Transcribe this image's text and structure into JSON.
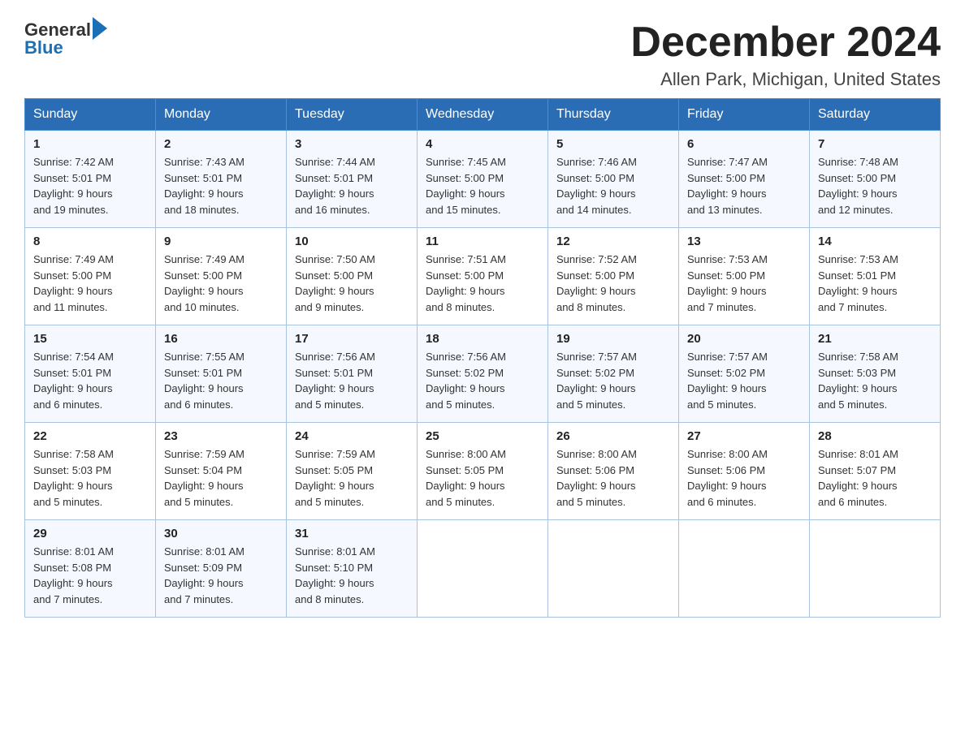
{
  "header": {
    "logo_general": "General",
    "logo_blue": "Blue",
    "month_title": "December 2024",
    "location": "Allen Park, Michigan, United States"
  },
  "days_of_week": [
    "Sunday",
    "Monday",
    "Tuesday",
    "Wednesday",
    "Thursday",
    "Friday",
    "Saturday"
  ],
  "weeks": [
    [
      {
        "day": "1",
        "sunrise": "7:42 AM",
        "sunset": "5:01 PM",
        "daylight": "9 hours and 19 minutes."
      },
      {
        "day": "2",
        "sunrise": "7:43 AM",
        "sunset": "5:01 PM",
        "daylight": "9 hours and 18 minutes."
      },
      {
        "day": "3",
        "sunrise": "7:44 AM",
        "sunset": "5:01 PM",
        "daylight": "9 hours and 16 minutes."
      },
      {
        "day": "4",
        "sunrise": "7:45 AM",
        "sunset": "5:00 PM",
        "daylight": "9 hours and 15 minutes."
      },
      {
        "day": "5",
        "sunrise": "7:46 AM",
        "sunset": "5:00 PM",
        "daylight": "9 hours and 14 minutes."
      },
      {
        "day": "6",
        "sunrise": "7:47 AM",
        "sunset": "5:00 PM",
        "daylight": "9 hours and 13 minutes."
      },
      {
        "day": "7",
        "sunrise": "7:48 AM",
        "sunset": "5:00 PM",
        "daylight": "9 hours and 12 minutes."
      }
    ],
    [
      {
        "day": "8",
        "sunrise": "7:49 AM",
        "sunset": "5:00 PM",
        "daylight": "9 hours and 11 minutes."
      },
      {
        "day": "9",
        "sunrise": "7:49 AM",
        "sunset": "5:00 PM",
        "daylight": "9 hours and 10 minutes."
      },
      {
        "day": "10",
        "sunrise": "7:50 AM",
        "sunset": "5:00 PM",
        "daylight": "9 hours and 9 minutes."
      },
      {
        "day": "11",
        "sunrise": "7:51 AM",
        "sunset": "5:00 PM",
        "daylight": "9 hours and 8 minutes."
      },
      {
        "day": "12",
        "sunrise": "7:52 AM",
        "sunset": "5:00 PM",
        "daylight": "9 hours and 8 minutes."
      },
      {
        "day": "13",
        "sunrise": "7:53 AM",
        "sunset": "5:00 PM",
        "daylight": "9 hours and 7 minutes."
      },
      {
        "day": "14",
        "sunrise": "7:53 AM",
        "sunset": "5:01 PM",
        "daylight": "9 hours and 7 minutes."
      }
    ],
    [
      {
        "day": "15",
        "sunrise": "7:54 AM",
        "sunset": "5:01 PM",
        "daylight": "9 hours and 6 minutes."
      },
      {
        "day": "16",
        "sunrise": "7:55 AM",
        "sunset": "5:01 PM",
        "daylight": "9 hours and 6 minutes."
      },
      {
        "day": "17",
        "sunrise": "7:56 AM",
        "sunset": "5:01 PM",
        "daylight": "9 hours and 5 minutes."
      },
      {
        "day": "18",
        "sunrise": "7:56 AM",
        "sunset": "5:02 PM",
        "daylight": "9 hours and 5 minutes."
      },
      {
        "day": "19",
        "sunrise": "7:57 AM",
        "sunset": "5:02 PM",
        "daylight": "9 hours and 5 minutes."
      },
      {
        "day": "20",
        "sunrise": "7:57 AM",
        "sunset": "5:02 PM",
        "daylight": "9 hours and 5 minutes."
      },
      {
        "day": "21",
        "sunrise": "7:58 AM",
        "sunset": "5:03 PM",
        "daylight": "9 hours and 5 minutes."
      }
    ],
    [
      {
        "day": "22",
        "sunrise": "7:58 AM",
        "sunset": "5:03 PM",
        "daylight": "9 hours and 5 minutes."
      },
      {
        "day": "23",
        "sunrise": "7:59 AM",
        "sunset": "5:04 PM",
        "daylight": "9 hours and 5 minutes."
      },
      {
        "day": "24",
        "sunrise": "7:59 AM",
        "sunset": "5:05 PM",
        "daylight": "9 hours and 5 minutes."
      },
      {
        "day": "25",
        "sunrise": "8:00 AM",
        "sunset": "5:05 PM",
        "daylight": "9 hours and 5 minutes."
      },
      {
        "day": "26",
        "sunrise": "8:00 AM",
        "sunset": "5:06 PM",
        "daylight": "9 hours and 5 minutes."
      },
      {
        "day": "27",
        "sunrise": "8:00 AM",
        "sunset": "5:06 PM",
        "daylight": "9 hours and 6 minutes."
      },
      {
        "day": "28",
        "sunrise": "8:01 AM",
        "sunset": "5:07 PM",
        "daylight": "9 hours and 6 minutes."
      }
    ],
    [
      {
        "day": "29",
        "sunrise": "8:01 AM",
        "sunset": "5:08 PM",
        "daylight": "9 hours and 7 minutes."
      },
      {
        "day": "30",
        "sunrise": "8:01 AM",
        "sunset": "5:09 PM",
        "daylight": "9 hours and 7 minutes."
      },
      {
        "day": "31",
        "sunrise": "8:01 AM",
        "sunset": "5:10 PM",
        "daylight": "9 hours and 8 minutes."
      },
      null,
      null,
      null,
      null
    ]
  ],
  "labels": {
    "sunrise": "Sunrise:",
    "sunset": "Sunset:",
    "daylight": "Daylight:"
  }
}
